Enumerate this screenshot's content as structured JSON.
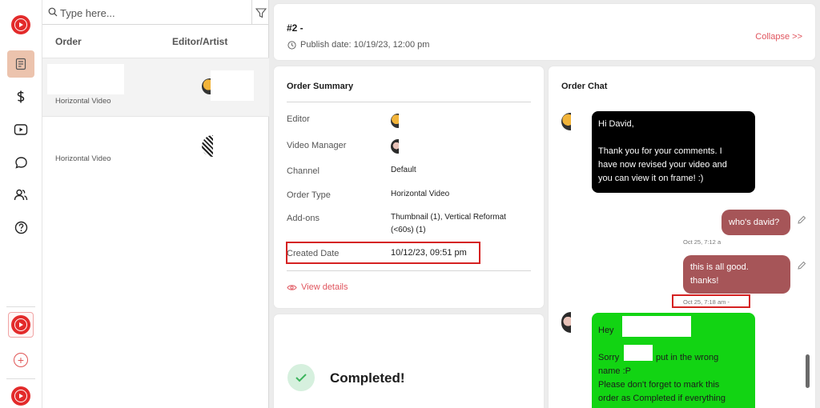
{
  "search": {
    "placeholder": "Type here..."
  },
  "list": {
    "columns": {
      "order": "Order",
      "editor_artist": "Editor/Artist"
    },
    "rows": [
      {
        "type": "Horizontal Video"
      },
      {
        "type": "Horizontal Video"
      }
    ]
  },
  "header": {
    "order_number": "#2 -",
    "publish_date": "Publish date: 10/19/23, 12:00 pm",
    "collapse_label": "Collapse  >>"
  },
  "summary": {
    "title": "Order Summary",
    "editor_label": "Editor",
    "video_manager_label": "Video Manager",
    "channel_label": "Channel",
    "channel_value": "Default",
    "order_type_label": "Order Type",
    "order_type_value": "Horizontal Video",
    "addons_label": "Add-ons",
    "addons_value_line1": "Thumbnail (1), Vertical Reformat",
    "addons_value_line2": "(<60s) (1)",
    "created_label": "Created Date",
    "created_value": "10/12/23, 09:51 pm",
    "view_details": "View details"
  },
  "status": {
    "label": "Completed!"
  },
  "chat": {
    "title": "Order Chat",
    "messages": [
      {
        "line1": "Hi David,",
        "line2": "Thank you for your comments. I",
        "line3": "have now revised your video and",
        "line4": "you can view it on frame! :)"
      },
      {
        "text": "who's david?",
        "timestamp": "Oct 25, 7:12 a"
      },
      {
        "line1": "this is all good.",
        "line2": "thanks!",
        "timestamp": "Oct 25, 7:18 am -"
      },
      {
        "line1": "Hey",
        "line2": "Sorry",
        "line2b": "put in the wrong",
        "line3": "name :P",
        "line4": "Please don't forget to mark this",
        "line5": "order as Completed if everything"
      }
    ]
  },
  "colors": {
    "accent": "#e0555e",
    "brand_red": "#e32b2b",
    "active_nav": "#ecc3ad",
    "highlight_box": "#d52121",
    "chat_sent": "#a65558",
    "chat_green": "#12d413"
  },
  "icons": {
    "nav": [
      "brand-logo-icon",
      "orders-icon",
      "dollar-icon",
      "video-icon",
      "chat-icon",
      "users-icon",
      "help-icon",
      "channel-logo-icon",
      "add-icon",
      "channel-logo-icon"
    ]
  }
}
